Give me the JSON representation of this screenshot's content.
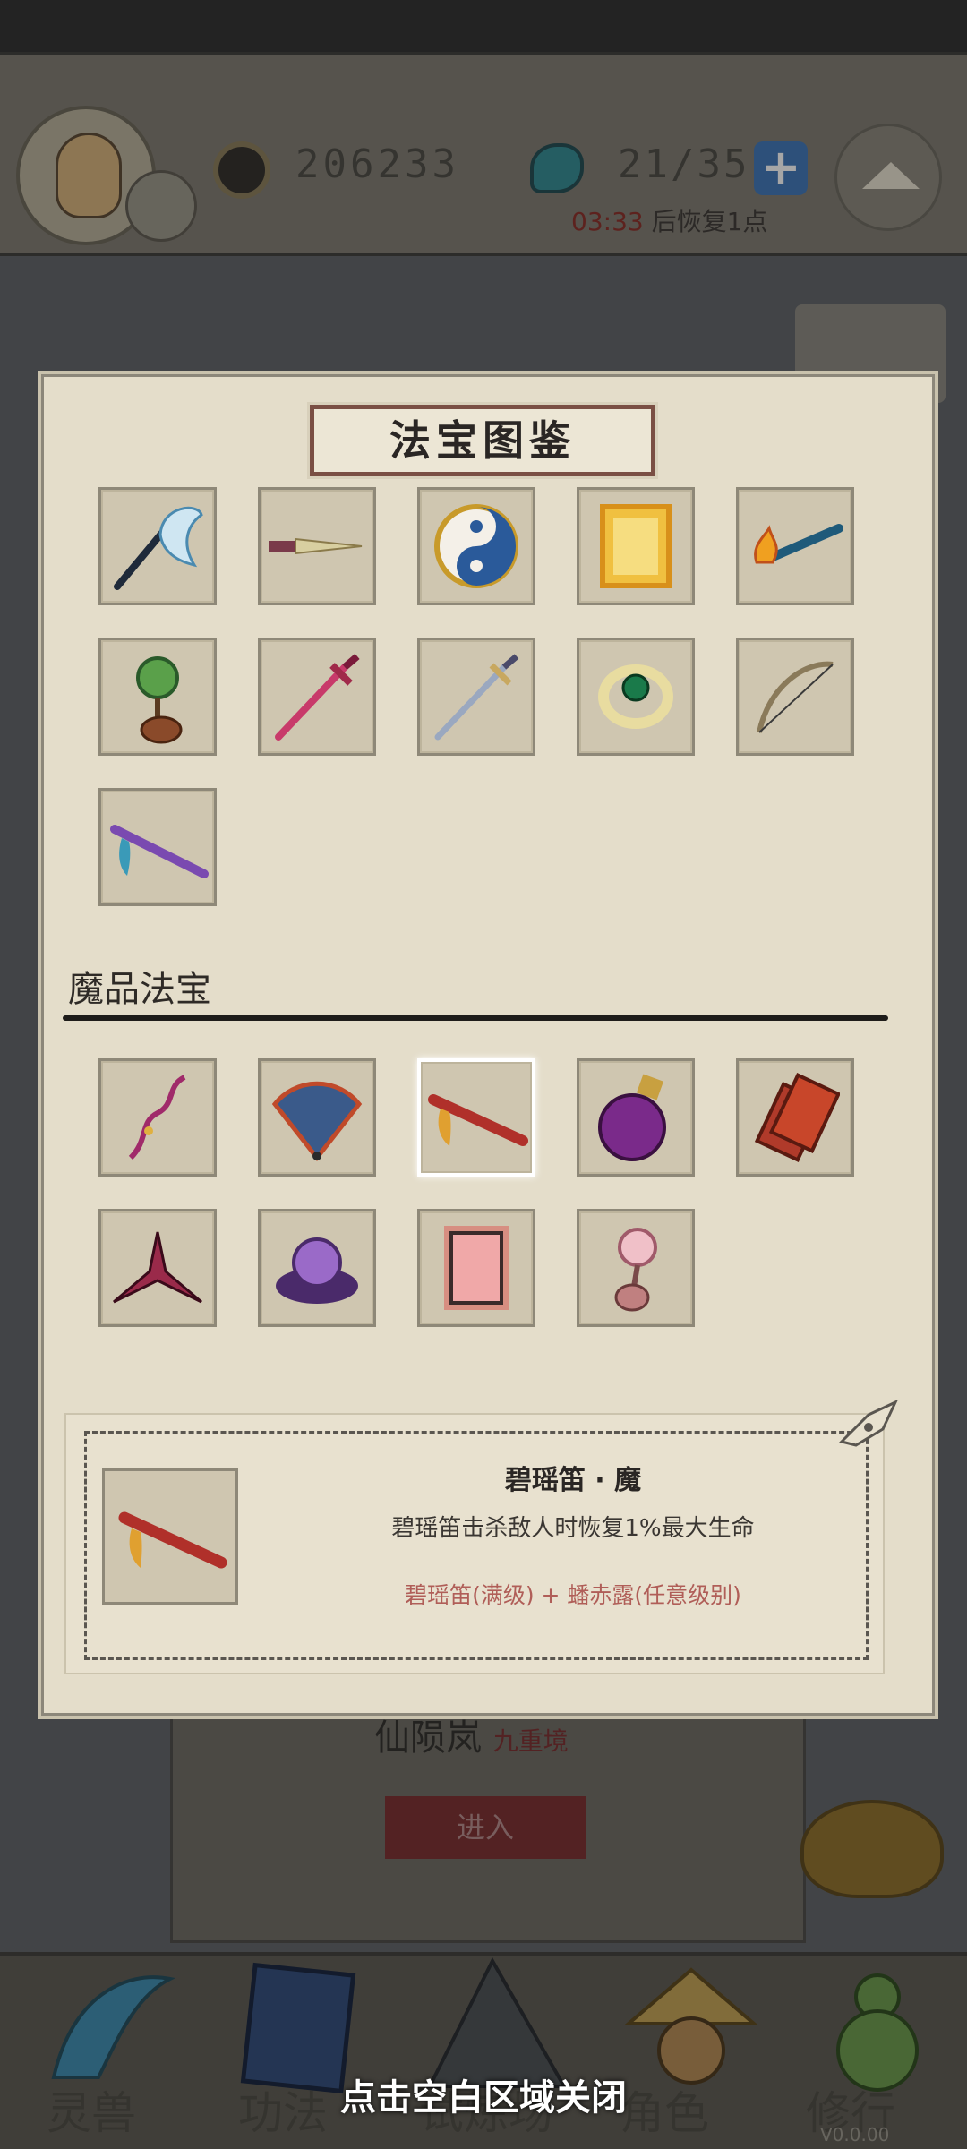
{
  "header": {
    "coins": "206233",
    "stamina": "21/35",
    "timer_time": "03:33",
    "timer_suffix": "后恢复1点"
  },
  "background": {
    "map_title": "仙陨岚",
    "map_subtitle": "九重境",
    "enter_button": "进入"
  },
  "modal": {
    "title": "法宝图鉴",
    "section_title": "魔品法宝",
    "normal_items": [
      "whisk-icon",
      "dagger-icon",
      "taiji-icon",
      "golden-talisman-icon",
      "torch-staff-icon",
      "jade-gourd-icon",
      "crimson-sword-icon",
      "steel-sword-icon",
      "jade-ring-icon",
      "bow-icon",
      "flute-icon"
    ],
    "demonic_items": [
      "demonic-whisk-icon",
      "demonic-fan-icon",
      "demonic-flute-icon",
      "demonic-potion-icon",
      "demonic-talisman-icon",
      "shuriken-icon",
      "demonic-lotus-icon",
      "red-talisman-icon",
      "pink-gourd-icon"
    ],
    "selected_index": 2,
    "detail": {
      "name": "碧瑶笛 · 魔",
      "description": "碧瑶笛击杀敌人时恢复1%最大生命",
      "recipe": "碧瑶笛(满级) + 蟠赤露(任意级别)"
    }
  },
  "bottom_nav": {
    "items": [
      "灵兽",
      "功法",
      "试炼场",
      "角色",
      "修行"
    ],
    "close_hint": "点击空白区域关闭",
    "version": "V0.0.00"
  },
  "colors": {
    "panel": "#e4ddca",
    "slot": "#cfc6b0",
    "title_border": "#7a4f44",
    "recipe_text": "#b05e58",
    "accent_blue": "#3c74b8"
  }
}
